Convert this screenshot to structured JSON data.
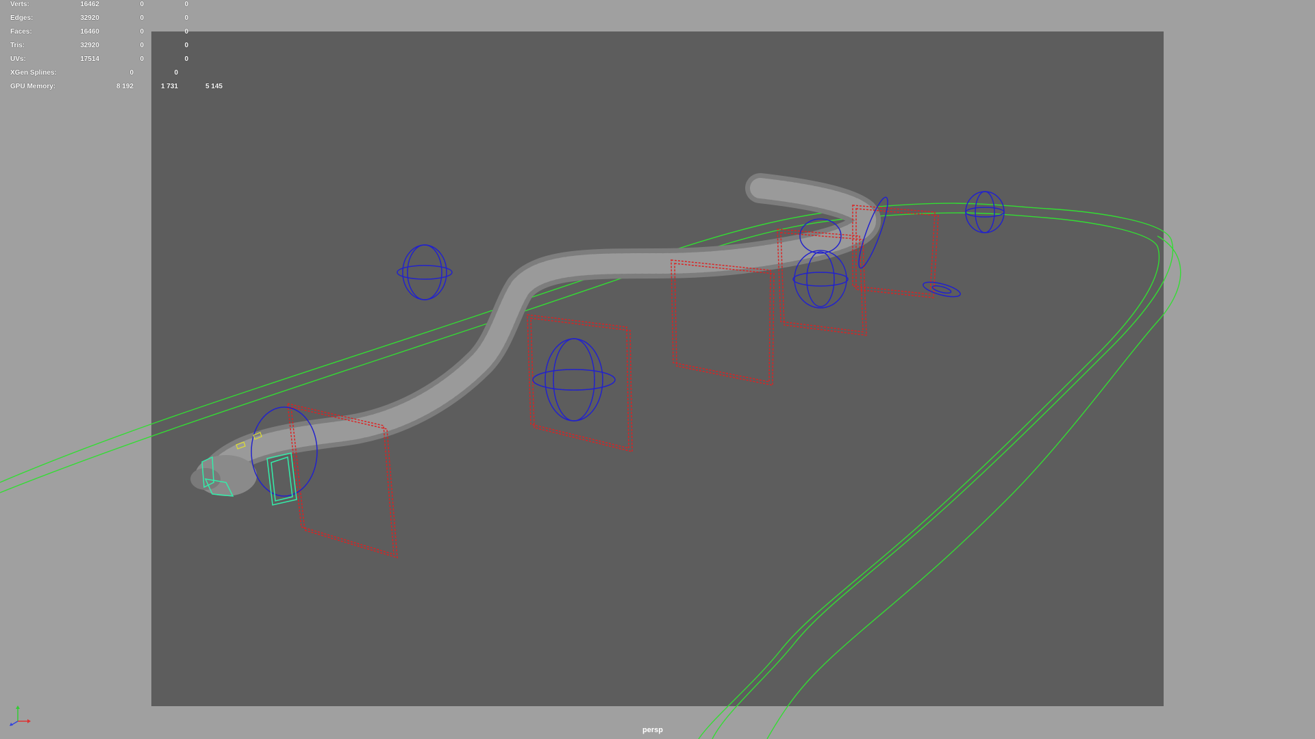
{
  "hud": {
    "rows": [
      {
        "label": "Verts:",
        "v0": "16462",
        "v1": "0",
        "v2": "0"
      },
      {
        "label": "Edges:",
        "v0": "32920",
        "v1": "0",
        "v2": "0"
      },
      {
        "label": "Faces:",
        "v0": "16460",
        "v1": "0",
        "v2": "0"
      },
      {
        "label": "Tris:",
        "v0": "32920",
        "v1": "0",
        "v2": "0"
      },
      {
        "label": "UVs:",
        "v0": "17514",
        "v1": "0",
        "v2": "0"
      },
      {
        "label": "XGen Splines:",
        "v0": "0",
        "v1": "0"
      },
      {
        "label": "GPU Memory:",
        "v0": "8 192",
        "v1": "1 731",
        "v2": "5 145"
      }
    ]
  },
  "camera": {
    "name": "persp"
  },
  "colors": {
    "viewport_bg": "#a0a0a0",
    "gate_bg": "#5d5d5d",
    "curve_green": "#33dd33",
    "control_red": "#dd2222",
    "control_blue": "#2222cc",
    "control_cyan": "#33eeaa",
    "mesh_gray": "#8a8a8a"
  },
  "scene": {
    "object": "snake-mesh",
    "icons": [
      "axis-gizmo-icon"
    ]
  }
}
